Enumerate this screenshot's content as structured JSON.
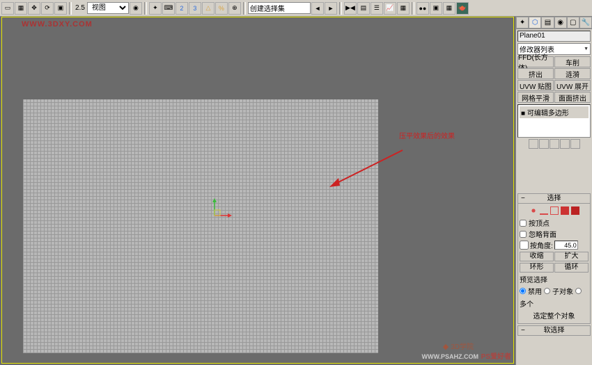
{
  "toolbar": {
    "scale_value": "2.5",
    "view_label": "视图",
    "selection_set": "创建选择集"
  },
  "watermarks": {
    "top": "WWW.3DXY.COM",
    "logo": "3D学院",
    "bottom": "PS爱好者",
    "url": "WWW.PSAHZ.COM"
  },
  "annotation": {
    "text": "压平效果后的效果"
  },
  "panel": {
    "object_name": "Plane01",
    "modifier_list": "修改器列表",
    "buttons": {
      "ffd": "FFD(长方体)",
      "bend": "车削",
      "extrude": "挤出",
      "wave": "涟漪",
      "uvw_map": "UVW 贴图",
      "uvw_unwrap": "UVW 展开",
      "meshsmooth": "网格平滑",
      "face_extrude": "面面挤出"
    },
    "stack": {
      "item1": "可编辑多边形"
    },
    "selection": {
      "title": "选择",
      "by_vertex": "按顶点",
      "ignore_back": "忽略背面",
      "by_angle": "按角度:",
      "angle_value": "45.0",
      "shrink": "收缩",
      "grow": "扩大",
      "ring": "环形",
      "loop": "循环",
      "preview_label": "预览选择",
      "disable": "禁用",
      "subobj": "子对象",
      "multi": "多个",
      "whole_object": "选定整个对象"
    },
    "soft_sel": {
      "title": "软选择"
    }
  },
  "colors": {
    "vert": "#2a6bdd",
    "edge": "#d94a4a",
    "border": "#228844",
    "poly": "#cc3333",
    "elem": "#bb2222"
  }
}
